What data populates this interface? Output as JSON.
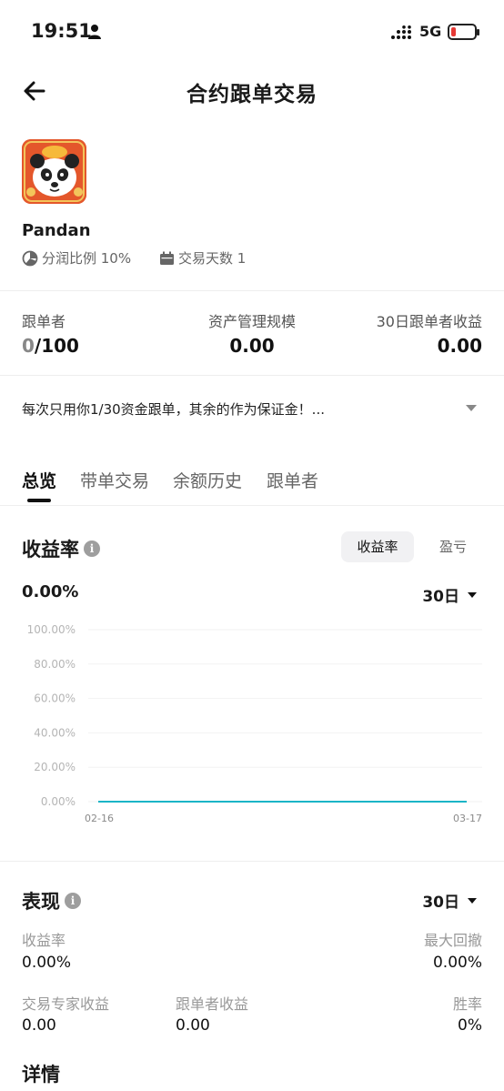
{
  "status_bar": {
    "time": "19:51",
    "network": "5G",
    "battery_level": 0.12,
    "battery_color": "#e53935"
  },
  "header": {
    "title": "合约跟单交易"
  },
  "profile": {
    "name": "Pandan",
    "profit_share": "分润比例 10%",
    "trading_days": "交易天数 1"
  },
  "stats": {
    "followers_label": "跟单者",
    "followers_current": "0",
    "followers_max": "/100",
    "aum_label": "资产管理规模",
    "aum_value": "0.00",
    "follower_pnl_label": "30日跟单者收益",
    "follower_pnl_value": "0.00"
  },
  "description": "每次只用你1/30资金跟单，其余的作为保证金！...",
  "tabs": [
    "总览",
    "带单交易",
    "余额历史",
    "跟单者"
  ],
  "returns": {
    "title": "收益率",
    "toggle_active": "收益率",
    "toggle_inactive": "盈亏",
    "current_value": "0.00%",
    "period": "30日"
  },
  "chart_data": {
    "type": "line",
    "y_ticks": [
      "100.00%",
      "80.00%",
      "60.00%",
      "40.00%",
      "20.00%",
      "0.00%"
    ],
    "ylim": [
      0,
      100
    ],
    "x_labels": [
      "02-16",
      "03-17"
    ],
    "series": [
      {
        "values": [
          0,
          0
        ],
        "color": "#1bb5c7"
      }
    ],
    "grid": true
  },
  "performance": {
    "title": "表现",
    "period": "30日",
    "roi_label": "收益率",
    "roi_value": "0.00%",
    "max_drawdown_label": "最大回撤",
    "max_drawdown_value": "0.00%",
    "expert_pnl_label": "交易专家收益",
    "expert_pnl_value": "0.00",
    "follower_pnl_label": "跟单者收益",
    "follower_pnl_value": "0.00",
    "win_rate_label": "胜率",
    "win_rate_value": "0%"
  },
  "details": {
    "title": "详情"
  }
}
